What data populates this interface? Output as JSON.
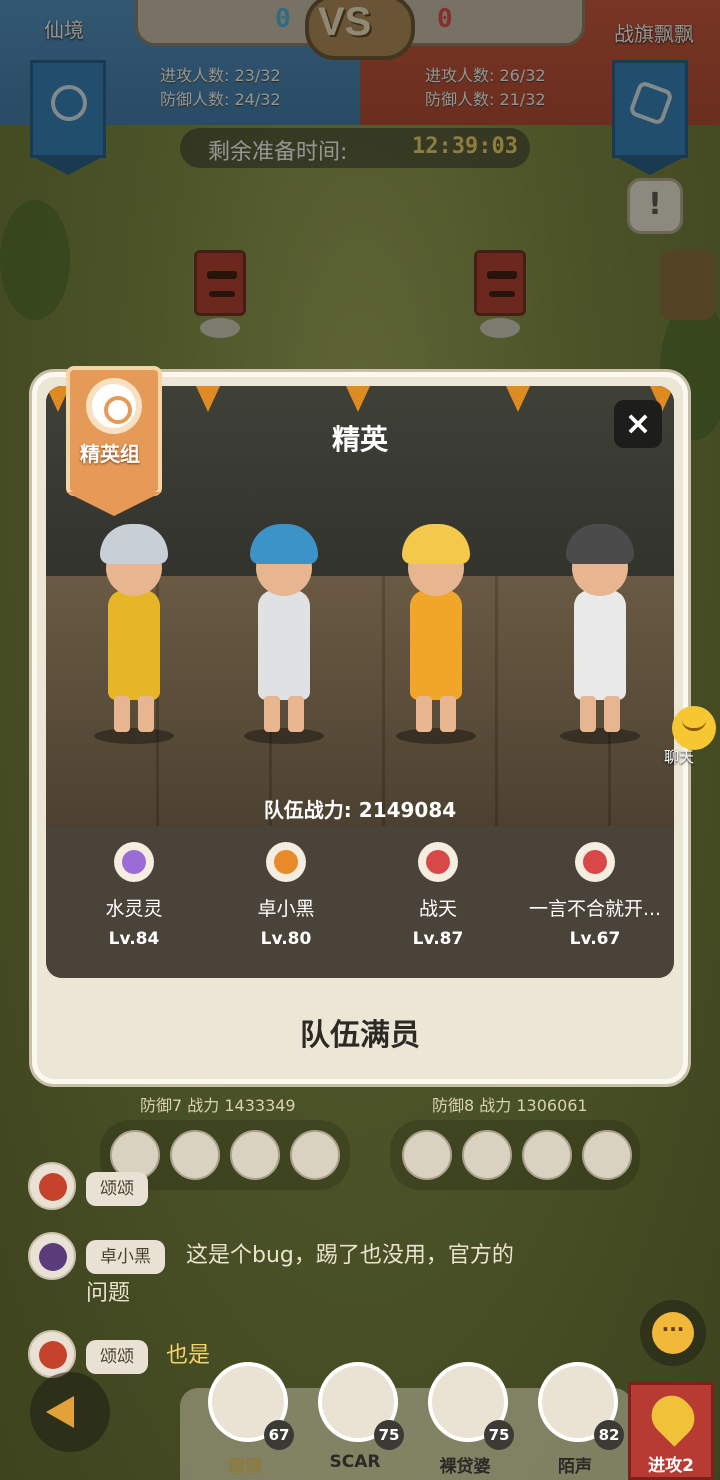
{
  "header": {
    "team_left": "仙境",
    "team_right": "战旗飘飘",
    "score_left": "0",
    "score_right": "0",
    "vs": "VS",
    "left_attack": "进攻人数: 23/32",
    "left_defense": "防御人数: 24/32",
    "right_attack": "进攻人数: 26/32",
    "right_defense": "防御人数: 21/32",
    "prep_label": "剩余准备时间:",
    "prep_time": "12:39:03",
    "alert": "!"
  },
  "modal": {
    "badge": "精英组",
    "title": "精英",
    "close": "×",
    "power": "队伍战力: 2149084",
    "members": [
      {
        "name": "水灵灵",
        "level": "Lv.84",
        "icon": "purple"
      },
      {
        "name": "卓小黑",
        "level": "Lv.80",
        "icon": "orange"
      },
      {
        "name": "战天",
        "level": "Lv.87",
        "icon": "red"
      },
      {
        "name": "一言不合就开...",
        "level": "Lv.67",
        "icon": "red"
      }
    ],
    "status": "队伍满员"
  },
  "chat_float": {
    "label": "聊天"
  },
  "defense": {
    "d7": "防御7 战力 1433349",
    "d8": "防御8 战力 1306061"
  },
  "chat": {
    "m1_name": "颂颂",
    "m2_name": "卓小黑",
    "m2_text_1": "这是个bug，踢了也没用，官方的",
    "m2_text_2": "问题",
    "m3_name": "颂颂",
    "m3_text": "也是"
  },
  "bottom": {
    "slots": [
      {
        "name": "颂颂",
        "level": "67"
      },
      {
        "name": "SCAR",
        "level": "75"
      },
      {
        "name": "裸贷婆",
        "level": "75"
      },
      {
        "name": "陌声",
        "level": "82"
      }
    ],
    "attack": "进攻2"
  },
  "colors": {
    "accent_blue": "#4ab3e6",
    "accent_red": "#e04747",
    "badge_orange": "#e59a57"
  }
}
